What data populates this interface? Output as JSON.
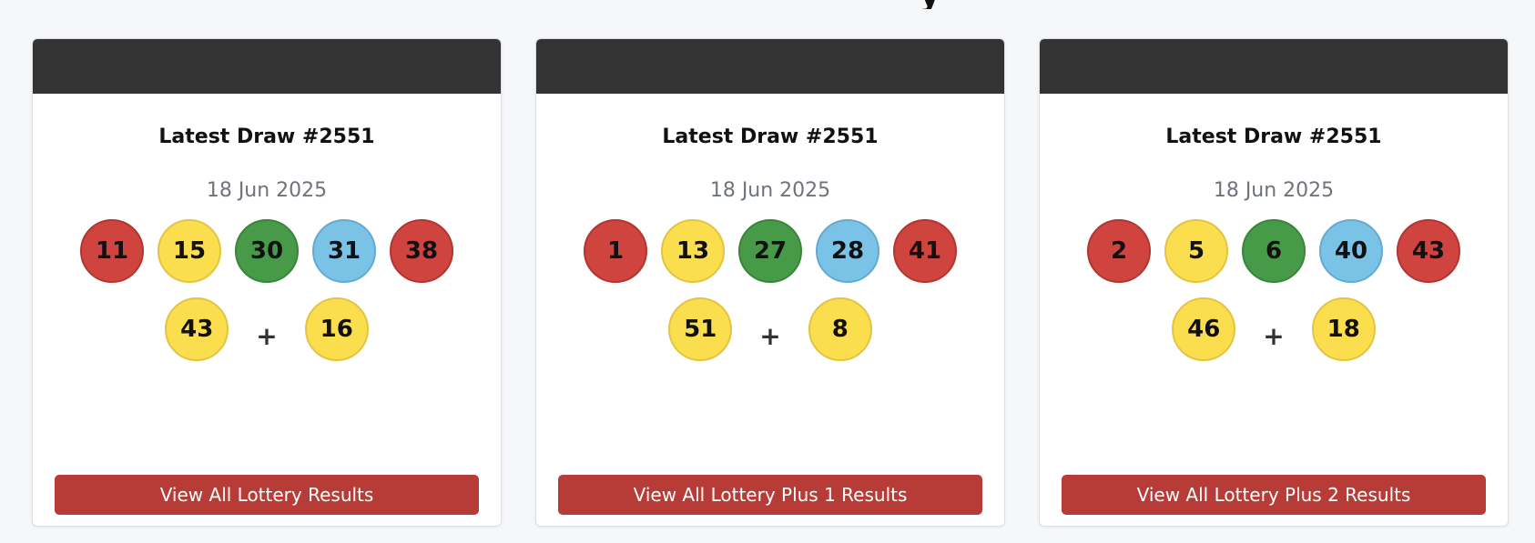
{
  "page": {
    "heading_fragment": "y"
  },
  "cards": [
    {
      "title": "Latest Draw #2551",
      "date": "18 Jun 2025",
      "main_balls": [
        {
          "number": "11",
          "color": "red"
        },
        {
          "number": "15",
          "color": "yellow"
        },
        {
          "number": "30",
          "color": "green"
        },
        {
          "number": "31",
          "color": "blue"
        },
        {
          "number": "38",
          "color": "red"
        },
        {
          "number": "43",
          "color": "yellow"
        }
      ],
      "plus_sign": "+",
      "bonus_ball": {
        "number": "16",
        "color": "yellow"
      },
      "button_label": "View All Lottery Results"
    },
    {
      "title": "Latest Draw #2551",
      "date": "18 Jun 2025",
      "main_balls": [
        {
          "number": "1",
          "color": "red"
        },
        {
          "number": "13",
          "color": "yellow"
        },
        {
          "number": "27",
          "color": "green"
        },
        {
          "number": "28",
          "color": "blue"
        },
        {
          "number": "41",
          "color": "red"
        },
        {
          "number": "51",
          "color": "yellow"
        }
      ],
      "plus_sign": "+",
      "bonus_ball": {
        "number": "8",
        "color": "yellow"
      },
      "button_label": "View All Lottery Plus 1 Results"
    },
    {
      "title": "Latest Draw #2551",
      "date": "18 Jun 2025",
      "main_balls": [
        {
          "number": "2",
          "color": "red"
        },
        {
          "number": "5",
          "color": "yellow"
        },
        {
          "number": "6",
          "color": "green"
        },
        {
          "number": "40",
          "color": "blue"
        },
        {
          "number": "43",
          "color": "red"
        },
        {
          "number": "46",
          "color": "yellow"
        }
      ],
      "plus_sign": "+",
      "bonus_ball": {
        "number": "18",
        "color": "yellow"
      },
      "button_label": "View All Lottery Plus 2 Results"
    }
  ],
  "colors": {
    "header_bar": "#333333",
    "button": "#b73c37",
    "ball_red": "#d04440",
    "ball_yellow": "#fbde4d",
    "ball_green": "#479b48",
    "ball_blue": "#7ac2e6"
  }
}
